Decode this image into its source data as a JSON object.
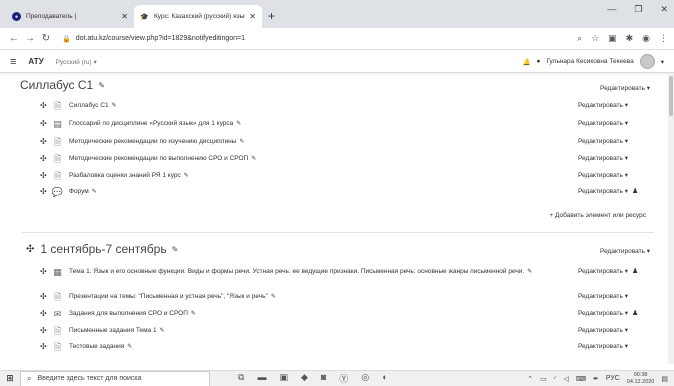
{
  "browser": {
    "tabs": [
      {
        "title": "Преподаватель |",
        "icon": "moodle-icon",
        "active": false
      },
      {
        "title": "Курс: Казахский (русский) язык",
        "icon": "course-icon",
        "active": true
      }
    ],
    "new_tab": "+",
    "url": "dot.atu.kz/course/view.php?id=1829&notifyeditingon=1"
  },
  "header": {
    "brand": "АТУ",
    "language": "Русский (ru) ▾",
    "user_name": "Гульнара Кесиковна Текеева"
  },
  "sections": [
    {
      "title": "Силлабус С1",
      "edit_label": "Редактировать ▾",
      "items": [
        {
          "name": "Силлабус С1",
          "edit": "Редактировать ▾",
          "icon": "file-icon"
        },
        {
          "name": "Глоссарий по дисциплине «Русский язык» для 1 курса",
          "edit": "Редактировать ▾",
          "icon": "glossary-icon"
        },
        {
          "name": "Методические рекомендации по изучению дисциплины",
          "edit": "Редактировать ▾",
          "icon": "file-icon"
        },
        {
          "name": "Методические рекомендации по выполнению СРО и СРОП",
          "edit": "Редактировать ▾",
          "icon": "file-icon"
        },
        {
          "name": "Разбаловка оценки знаний РЯ 1 курс",
          "edit": "Редактировать ▾",
          "icon": "file-icon"
        },
        {
          "name": "Форум",
          "edit": "Редактировать ▾",
          "icon": "forum-icon",
          "user": true
        }
      ],
      "add_resource": "+ Добавить элемент или ресурс"
    },
    {
      "title": "1 сентябрь-7 сентябрь",
      "edit_label": "Редактировать ▾",
      "items": [
        {
          "name": "Тема 1. Язык и его основные функции. Виды и формы речи. Устная речь: ее ведущие признаки. Письменная речь: основные жанры письменной речи.",
          "edit": "Редактировать ▾",
          "icon": "page-icon",
          "user": true
        },
        {
          "name": "Презентации на темы: \"Письменная и устная речь\", \"Язык и речь\"",
          "edit": "Редактировать ▾",
          "icon": "file-icon"
        },
        {
          "name": "Задания для выполнения СРО и СРОП",
          "edit": "Редактировать ▾",
          "icon": "assignment-icon",
          "user": true
        },
        {
          "name": "Письменные задания Тема 1",
          "edit": "Редактировать ▾",
          "icon": "file-icon"
        },
        {
          "name": "Тестовые задания",
          "edit": "Редактировать ▾",
          "icon": "file-icon"
        }
      ]
    }
  ],
  "taskbar": {
    "search_placeholder": "Введите здесь текст для поиска",
    "lang": "РУС",
    "time": "00:38",
    "date": "04.12.2020"
  }
}
